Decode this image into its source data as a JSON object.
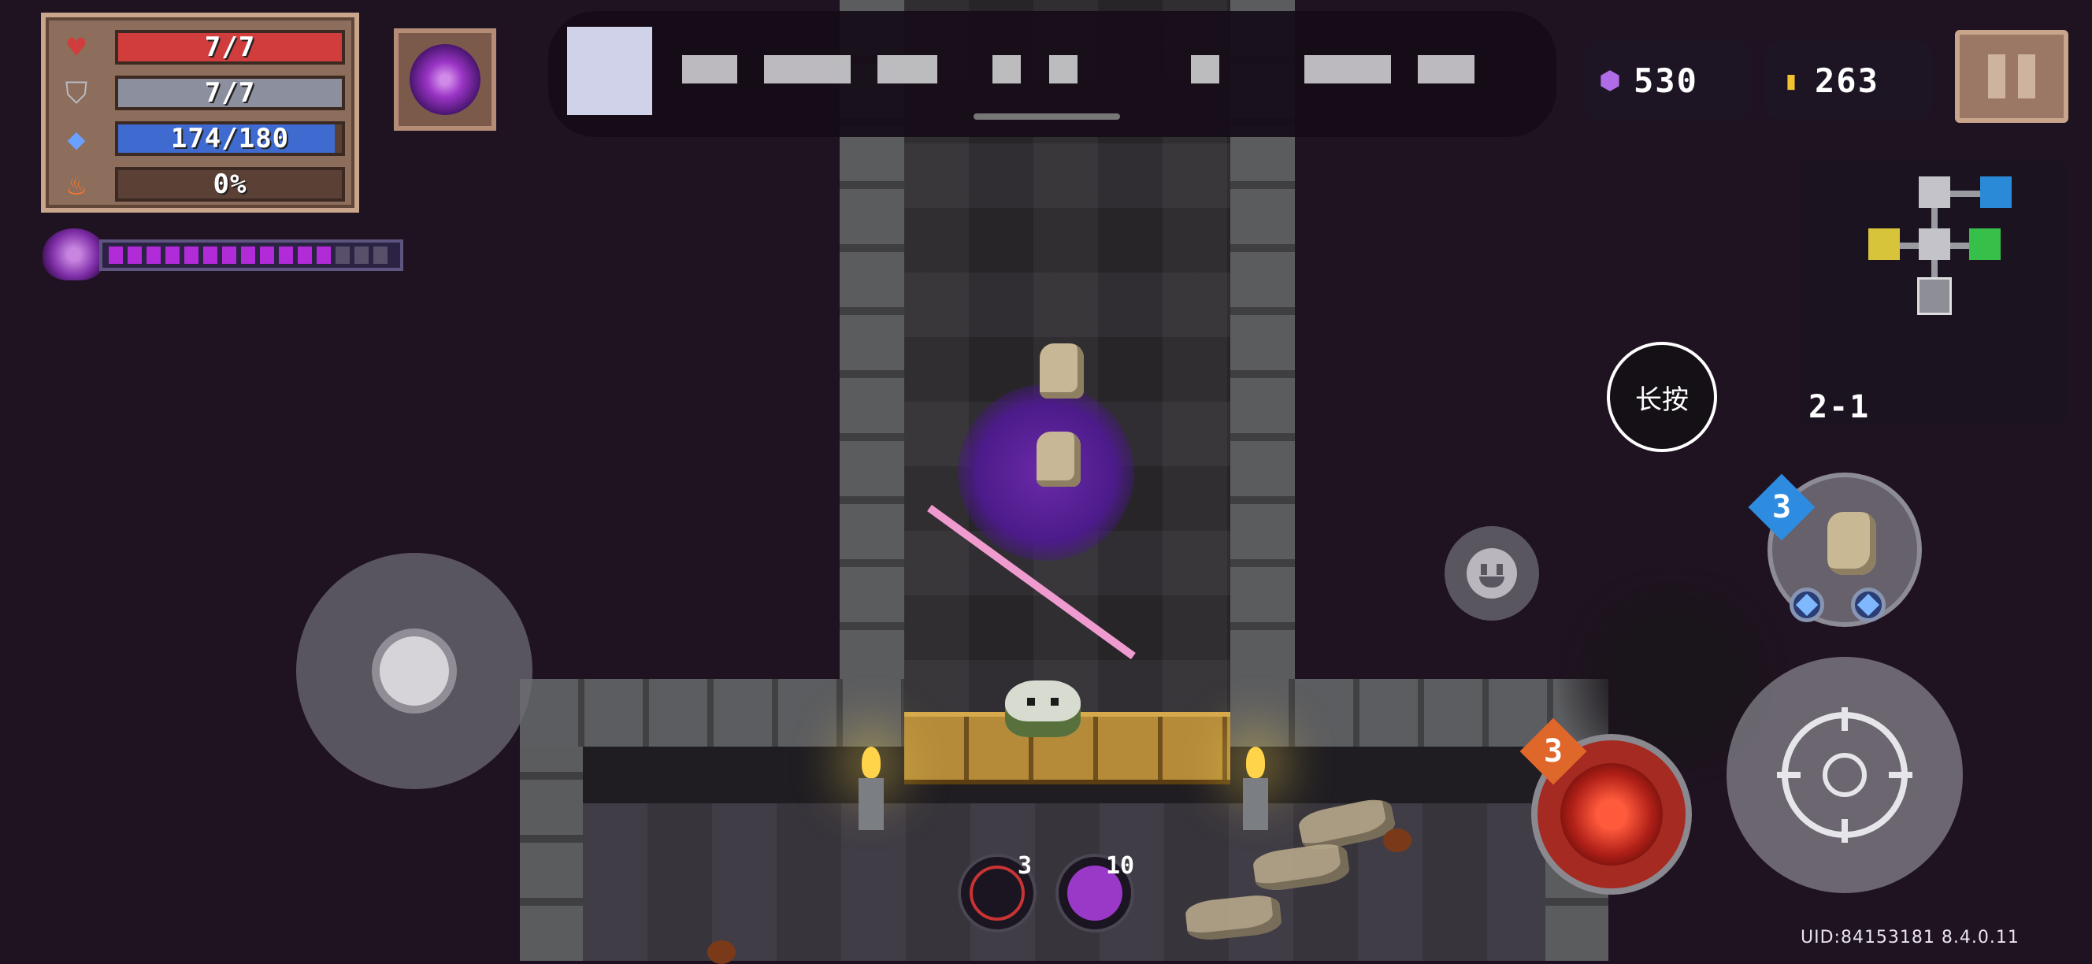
{
  "stats": {
    "health": {
      "text": "7/7",
      "fraction": 1.0,
      "color": "#d13d3d"
    },
    "armor": {
      "text": "7/7",
      "fraction": 1.0,
      "color": "#8b8f9e"
    },
    "energy": {
      "text": "174/180",
      "fraction": 0.967,
      "color": "#3f6ad0"
    },
    "rage": {
      "text": "0%",
      "fraction": 0.0,
      "color": "#d66a2a"
    }
  },
  "skill_charge": {
    "filled_segments": 12,
    "total_segments": 15
  },
  "currency": {
    "gems": {
      "icon": "purple-gem-icon",
      "value": "530"
    },
    "coins": {
      "icon": "gold-coin-icon",
      "value": "263"
    }
  },
  "minimap": {
    "level": "2-1"
  },
  "controls": {
    "longpress_label": "长按",
    "weapon_energy_cost": "3",
    "skill_charges": "3"
  },
  "buffs": [
    {
      "icon": "crosshair-buff-icon",
      "count": "3"
    },
    {
      "icon": "purple-skull-buff-icon",
      "count": "10"
    }
  ],
  "footer": {
    "uid": "UID:84153181 8.4.0.11"
  },
  "colors": {
    "energy_segment": "#b22bd9",
    "accent_purple": "#6b2aa8"
  }
}
